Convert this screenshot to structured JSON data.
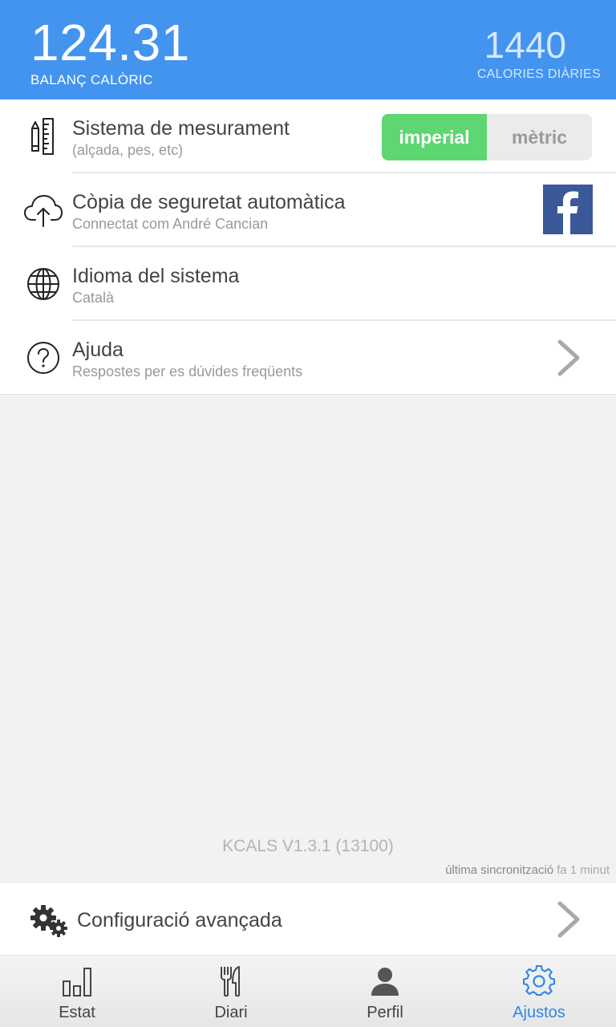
{
  "header": {
    "balance_value": "124.31",
    "balance_label": "BALANÇ CALÒRIC",
    "daily_value": "1440",
    "daily_label": "CALORIES DIÀRIES",
    "accent_color": "#4394ef"
  },
  "settings": [
    {
      "icon": "pencil-ruler-icon",
      "title": "Sistema de mesurament",
      "subtitle": "(alçada, pes, etc)",
      "toggle": {
        "options": [
          "imperial",
          "mètric"
        ],
        "selected": "imperial"
      }
    },
    {
      "icon": "cloud-upload-icon",
      "title": "Còpia de seguretat automàtica",
      "subtitle": "Connectat com André Cancian",
      "action_icon": "facebook-icon"
    },
    {
      "icon": "globe-icon",
      "title": "Idioma del sistema",
      "subtitle": "Català"
    },
    {
      "icon": "help-icon",
      "title": "Ajuda",
      "subtitle": "Respostes per es dúvides freqüents",
      "action_icon": "chevron-right-icon"
    }
  ],
  "version": "KCALS V1.3.1 (13100)",
  "sync": {
    "label": "última sincronització",
    "ago": "fa 1 minut"
  },
  "advanced": {
    "label": "Configuració avançada",
    "icon": "gears-icon"
  },
  "tabs": [
    {
      "label": "Estat",
      "icon": "bar-chart-icon",
      "active": false
    },
    {
      "label": "Diari",
      "icon": "fork-knife-icon",
      "active": false
    },
    {
      "label": "Perfil",
      "icon": "person-icon",
      "active": false
    },
    {
      "label": "Ajustos",
      "icon": "gear-icon",
      "active": true
    }
  ],
  "toggle_on_color": "#5ed672",
  "tab_active_color": "#2f86e8"
}
